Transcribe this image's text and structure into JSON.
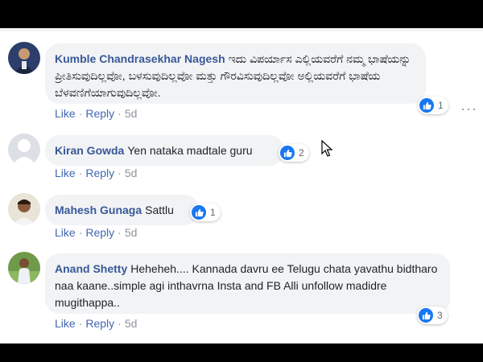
{
  "comments": [
    {
      "author": "Kumble Chandrasekhar Nagesh",
      "text": "ಇದು ವಿಪರ್ಯಾಸ ಎಲ್ಲಿಯವರೆಗೆ ನಮ್ಮ ಭಾಷೆಯನ್ನು ಪ್ರೀತಿಸುವುದಿಲ್ಲವೋ, ಬಳಸುವುದಿಲ್ಲವೋ ಮತ್ತು ಗೌರವಿಸುವುದಿಲ್ಲವೋ ಅಲ್ಲಿಯವರೆಗೆ ಭಾಷೆಯ ಬೆಳವಣಿಗೆಯಾಗುವುದಿಲ್ಲವೋ.",
      "reactions": "1",
      "like": "Like",
      "reply": "Reply",
      "time": "5d"
    },
    {
      "author": "Kiran Gowda",
      "text": "Yen nataka madtale guru",
      "reactions": "2",
      "like": "Like",
      "reply": "Reply",
      "time": "5d"
    },
    {
      "author": "Mahesh Gunaga",
      "text": "Sattlu",
      "reactions": "1",
      "like": "Like",
      "reply": "Reply",
      "time": "5d"
    },
    {
      "author": "Anand Shetty",
      "text": "Heheheh.... Kannada davru ee Telugu chata yavathu bidtharo naa kaane..simple agi inthavrna Insta and FB Alli unfollow madidre mugithappa..",
      "reactions": "3",
      "like": "Like",
      "reply": "Reply",
      "time": "5d"
    }
  ],
  "separator": "·",
  "more_label": "···",
  "icons": {
    "like": "thumbs-up-icon",
    "more": "more-options-icon",
    "cursor": "mouse-cursor-icon"
  },
  "colors": {
    "author": "#385898",
    "action_link": "#4267b2",
    "bubble": "#f2f3f5",
    "like_blue": "#1877f2"
  }
}
